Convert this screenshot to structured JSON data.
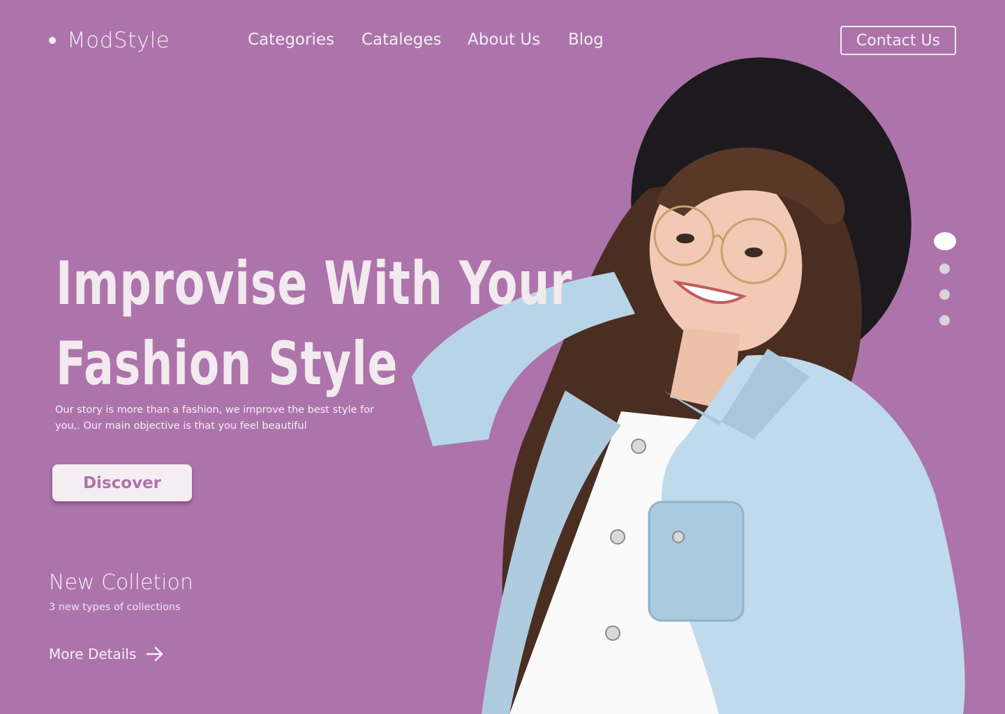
{
  "brand": {
    "name": "ModStyle"
  },
  "nav": {
    "items": [
      {
        "label": "Categories"
      },
      {
        "label": "Cataleges"
      },
      {
        "label": "About Us"
      },
      {
        "label": "Blog"
      }
    ]
  },
  "header": {
    "contact_label": "Contact Us"
  },
  "hero": {
    "headline_line1": "Improvise With Your",
    "headline_line2": "Fashion Style",
    "subtitle": "Our story is more than a fashion, we improve the best style for you,. Our main objective is that you feel beautiful",
    "cta_label": "Discover"
  },
  "collection": {
    "title": "New Colletion",
    "subtitle": "3 new types of collections",
    "link_label": "More Details"
  },
  "slider": {
    "count": 4,
    "active_index": 0
  },
  "colors": {
    "background": "#AD73AB",
    "text": "#F3EEF3",
    "button_bg": "#F4EEF2",
    "button_text": "#AD73AB"
  }
}
